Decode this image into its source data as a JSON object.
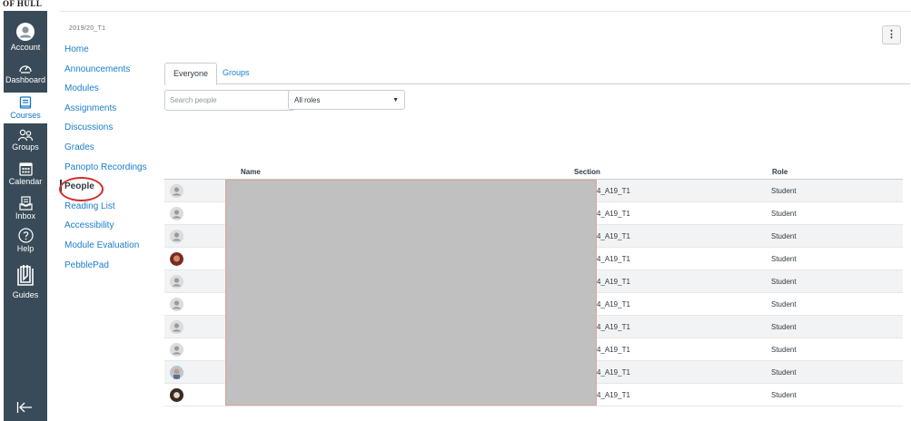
{
  "brand": {
    "logo_text": "OF HULL"
  },
  "global_nav": [
    {
      "label": "Account",
      "icon": "account-icon"
    },
    {
      "label": "Dashboard",
      "icon": "dashboard-icon"
    },
    {
      "label": "Courses",
      "icon": "courses-icon",
      "active": true
    },
    {
      "label": "Groups",
      "icon": "groups-icon"
    },
    {
      "label": "Calendar",
      "icon": "calendar-icon"
    },
    {
      "label": "Inbox",
      "icon": "inbox-icon"
    },
    {
      "label": "Help",
      "icon": "help-icon"
    },
    {
      "label": "Guides",
      "icon": "guides-icon"
    }
  ],
  "course": {
    "code": "2019/20_T1"
  },
  "course_nav": [
    "Home",
    "Announcements",
    "Modules",
    "Assignments",
    "Discussions",
    "Grades",
    "Panopto Recordings",
    "People",
    "Reading List",
    "Accessibility",
    "Module Evaluation",
    "PebblePad"
  ],
  "current_page": "People",
  "tabs": {
    "everyone": "Everyone",
    "groups": "Groups"
  },
  "search": {
    "placeholder": "Search people"
  },
  "roles_filter": {
    "selected": "All roles"
  },
  "table": {
    "headers": {
      "name": "Name",
      "section": "Section",
      "role": "Role"
    },
    "rows": [
      {
        "section": "4_A19_T1",
        "role": "Student",
        "avatar": "default"
      },
      {
        "section": "4_A19_T1",
        "role": "Student",
        "avatar": "default"
      },
      {
        "section": "4_A19_T1",
        "role": "Student",
        "avatar": "default"
      },
      {
        "section": "4_A19_T1",
        "role": "Student",
        "avatar": "photo"
      },
      {
        "section": "4_A19_T1",
        "role": "Student",
        "avatar": "default"
      },
      {
        "section": "4_A19_T1",
        "role": "Student",
        "avatar": "default"
      },
      {
        "section": "4_A19_T1",
        "role": "Student",
        "avatar": "default"
      },
      {
        "section": "4_A19_T1",
        "role": "Student",
        "avatar": "default"
      },
      {
        "section": "4_A19_T1",
        "role": "Student",
        "avatar": "photo"
      },
      {
        "section": "4_A19_T1",
        "role": "Student",
        "avatar": "photo"
      }
    ]
  },
  "colors": {
    "nav_bg": "#394b58",
    "link": "#1b7ecd",
    "highlight_circle": "#d22d2d",
    "redaction": "#c0c0c0"
  }
}
